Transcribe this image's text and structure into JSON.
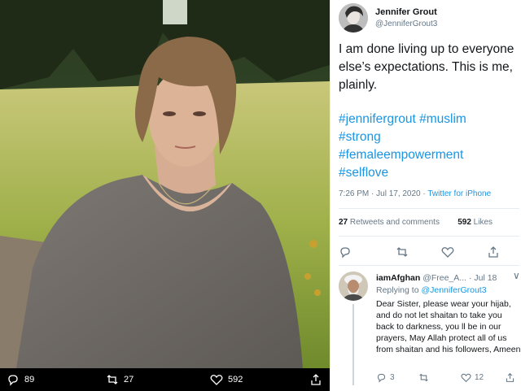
{
  "photo": {
    "reply_count": "89",
    "retweet_count": "27",
    "like_count": "592",
    "icons": [
      "reply-icon",
      "retweet-icon",
      "like-icon",
      "share-icon"
    ]
  },
  "tweet": {
    "author_name": "Jennifer Grout",
    "author_handle": "@JenniferGrout3",
    "text": "I am done living up to everyone else’s expectations. This is me, plainly.",
    "hashtags": [
      "#jennifergrout",
      "#muslim",
      "#strong",
      "#femaleempowerment",
      "#selflove"
    ],
    "timestamp": "7:26 PM · Jul 17, 2020 · ",
    "source": "Twitter for iPhone",
    "retweets_count": "27",
    "retweets_label": "Retweets and comments",
    "likes_count": "592",
    "likes_label": "Likes",
    "icons": [
      "reply-icon",
      "retweet-icon",
      "like-icon",
      "share-icon"
    ]
  },
  "reply": {
    "author_name": "iamAfghan",
    "author_handle_date": "@Free_A... · Jul 18",
    "more": "∨",
    "replying_prefix": "Replying to ",
    "replying_to": "@JenniferGrout3",
    "text": "Dear Sister, please wear your hijab, and do not let shaitan to take you back to darkness, you ll be in our prayers, May Allah protect all of us from shaitan and his followers, Ameen",
    "reply_count": "3",
    "retweet_count": "",
    "like_count": "12"
  },
  "colors": {
    "link": "#1b95e0",
    "secondary_text": "#657786",
    "primary_text": "#14171a",
    "divider": "#e6ecf0"
  }
}
